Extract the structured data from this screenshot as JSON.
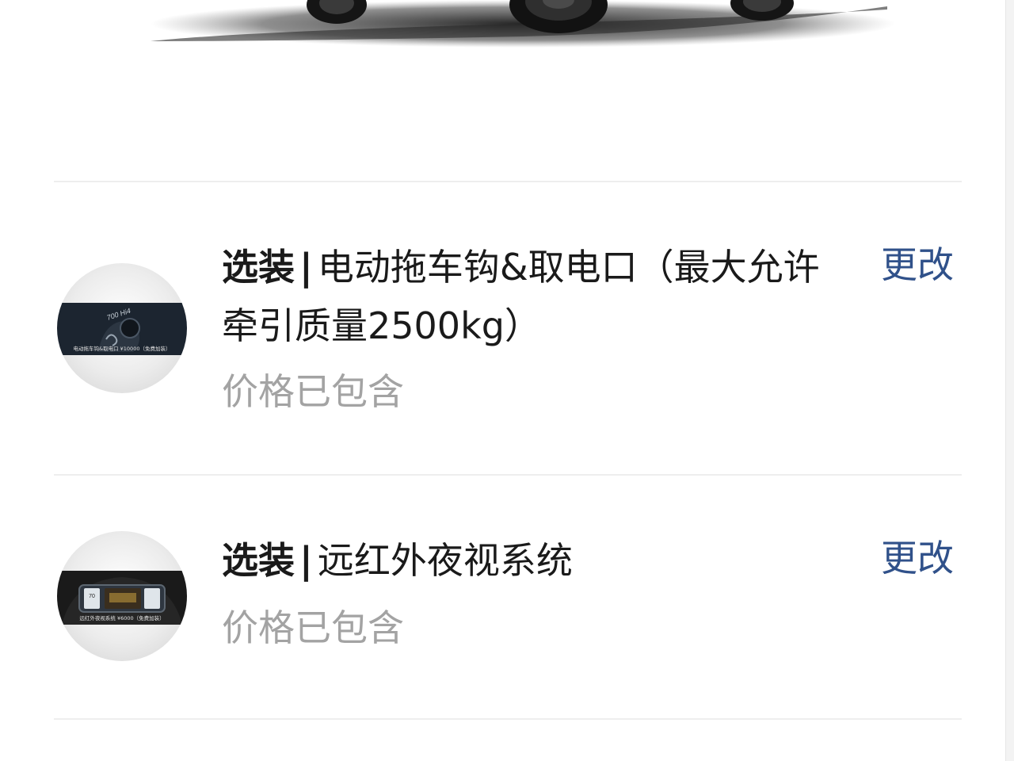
{
  "options": [
    {
      "prefix": "选装",
      "separator": "|",
      "title": "电动拖车钩&取电口（最大允许牵引质量2500kg）",
      "price_status": "价格已包含",
      "change_label": "更改",
      "thumb_caption": "电动拖车钩&取电口 ¥10000（免费加装）",
      "thumb_badge": "700 Hi4"
    },
    {
      "prefix": "选装",
      "separator": "|",
      "title": "远红外夜视系统",
      "price_status": "价格已包含",
      "change_label": "更改",
      "thumb_caption": "远红外夜视系统 ¥6000（免费加装）",
      "thumb_readout": "70"
    }
  ],
  "colors": {
    "link": "#30518a",
    "muted": "#a3a3a3",
    "text": "#1a1a1a",
    "divider": "#eeeeee"
  }
}
